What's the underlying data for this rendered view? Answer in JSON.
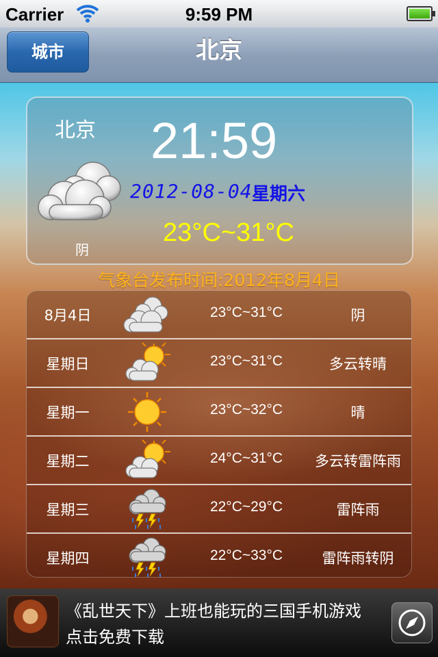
{
  "status_bar": {
    "carrier": "Carrier",
    "time": "9:59 PM",
    "wifi_icon": "wifi-icon",
    "battery_icon": "battery-icon"
  },
  "navbar": {
    "city_button": "城市",
    "title": "北京"
  },
  "current": {
    "city": "北京",
    "time": "21:59",
    "date": "2012-08-04",
    "weekday": "星期六",
    "temp_range": "23°C~31°C",
    "condition": "阴",
    "icon": "cloudy-icon"
  },
  "publish_time": "气象台发布时间:2012年8月4日",
  "forecast": [
    {
      "day": "8月4日",
      "icon": "cloudy-icon",
      "range": "23°C~31°C",
      "condition": "阴"
    },
    {
      "day": "星期日",
      "icon": "partly-sunny-icon",
      "range": "23°C~31°C",
      "condition": "多云转晴"
    },
    {
      "day": "星期一",
      "icon": "sunny-icon",
      "range": "23°C~32°C",
      "condition": "晴"
    },
    {
      "day": "星期二",
      "icon": "partly-sunny-icon",
      "range": "24°C~31°C",
      "condition": "多云转雷阵雨"
    },
    {
      "day": "星期三",
      "icon": "thunderstorm-icon",
      "range": "22°C~29°C",
      "condition": "雷阵雨"
    },
    {
      "day": "星期四",
      "icon": "thunderstorm-icon",
      "range": "22°C~33°C",
      "condition": "雷阵雨转阴"
    }
  ],
  "ad": {
    "text": "《乱世天下》上班也能玩的三国手机游戏 点击免费下载",
    "compass_icon": "compass-icon"
  },
  "colors": {
    "date": "#1414e6",
    "temp": "#ffff00",
    "publish": "#ffb21a",
    "nav_button": "#2a68ae"
  }
}
